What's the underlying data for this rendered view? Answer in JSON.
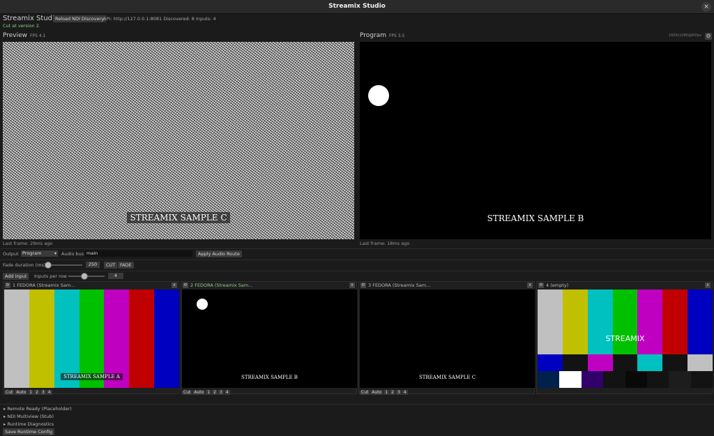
{
  "window": {
    "title": "Streamix Studio",
    "close": "×"
  },
  "topbar": {
    "app_name": "Streamix Studio",
    "reload_label": "Reload NDI Discovery",
    "api_status": "API: http://127.0.0.1:8081   Discovered: 8   Inputs: 4",
    "cut_message": "Cut at version 2."
  },
  "preview": {
    "label": "Preview",
    "fps": "FPS 4.1",
    "overlay": "STREAMIX SAMPLE C",
    "last_frame": "Last frame: 29ms ago"
  },
  "program": {
    "label": "Program",
    "fps": "FPS 3.5",
    "overlay": "STREAMIX SAMPLE B",
    "last_frame": "Last frame: 18ms ago",
    "resolution": "1920x1080@60fps"
  },
  "output_row": {
    "output_label": "Output",
    "output_value": "Program",
    "audio_label": "Audio bus",
    "audio_value": "main",
    "apply_label": "Apply Audio Route"
  },
  "fade_row": {
    "fade_label": "Fade duration (ms)",
    "fade_value": "250",
    "fade_fraction": 0.06,
    "cut_label": "CUT",
    "fade_btn_label": "FADE"
  },
  "inputs_row": {
    "add_label": "Add input",
    "per_row_label": "Inputs per row",
    "per_row_value": "4",
    "per_row_fraction": 0.45
  },
  "tiles": [
    {
      "title": "1 FEDORA (Streamix Sam...",
      "overlay": "STREAMIX SAMPLE A"
    },
    {
      "title": "2 FEDORA (Streamix Sam...",
      "overlay": "STREAMIX SAMPLE B"
    },
    {
      "title": "3 FEDORA (Streamix Sam...",
      "overlay": "STREAMIX SAMPLE C"
    },
    {
      "title": "4 (empty)",
      "overlay": "STREAMIX"
    }
  ],
  "tile_actions": {
    "cut": "Cut",
    "auto": "Auto",
    "n1": "1",
    "n2": "2",
    "n3": "3",
    "n4": "4"
  },
  "colors": {
    "bars_top": [
      "#c0c0c0",
      "#c0c000",
      "#00c0c0",
      "#00c000",
      "#c000c0",
      "#c00000",
      "#0000c0"
    ],
    "bars_mid": [
      "#0000c0",
      "#131313",
      "#c000c0",
      "#131313",
      "#00c0c0",
      "#131313",
      "#c0c0c0"
    ],
    "bars_bottom": [
      "#00214c",
      "#ffffff",
      "#32006a",
      "#131313",
      "#090909",
      "#131313",
      "#1d1d1d",
      "#131313"
    ],
    "active_tile": "#8fd08f"
  },
  "sections": [
    "▸ Remote Ready (Placeholder)",
    "▸ NDI Multiview (Stub)",
    "▸ Runtime Diagnostics"
  ],
  "save_label": "Save Runtime Config",
  "icons": {
    "gear": "⚙",
    "close": "x",
    "caret": "▾"
  }
}
